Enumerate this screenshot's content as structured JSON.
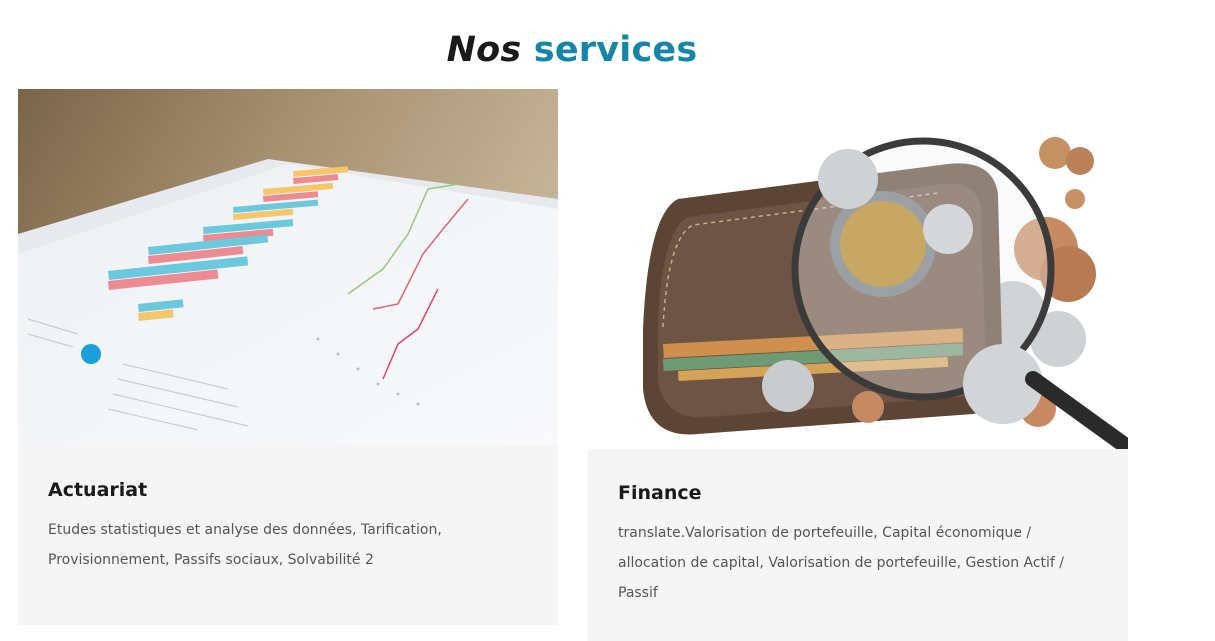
{
  "section": {
    "title_word1": "Nos",
    "title_word2": "services"
  },
  "cards": [
    {
      "title": "Actuariat",
      "text": "Etudes statistiques et analyse des données, Tarification, Provisionnement, Passifs sociaux, Solvabilité 2",
      "image_icon": "charts-on-paper-image"
    },
    {
      "title": "Finance",
      "text": "translate.Valorisation de portefeuille, Capital économique / allocation de capital, Valorisation de portefeuille, Gestion Actif / Passif",
      "image_icon": "wallet-magnifier-image"
    }
  ],
  "colors": {
    "accent": "#1685a8",
    "card_bg": "#f5f5f5"
  }
}
